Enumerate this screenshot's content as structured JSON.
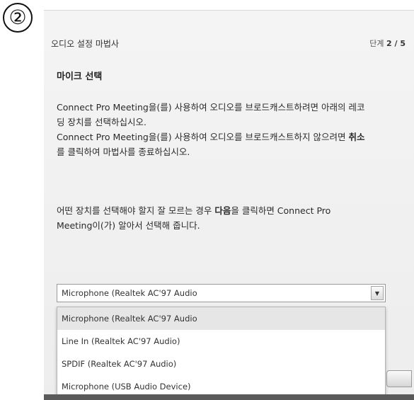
{
  "marker": {
    "label": "②"
  },
  "wizard": {
    "title": "오디오 설정 마법사",
    "step_prefix": "단계",
    "step_current": "2 / 5",
    "section_title": "마이크 선택",
    "instructions": [
      "Connect Pro Meeting을(를) 사용하여 오디오를 브로드캐스트하려면 아래의 레코",
      "딩 장치를 선택하십시오.",
      "Connect Pro Meeting을(를) 사용하여 오디오를 브로드캐스트하지 않으려면 "
    ],
    "instructions_bold": "취소",
    "instructions_tail": "를 클릭하여 마법사를 종료하십시오.",
    "hint_start": "어떤 장치를 선택해야 할지 잘 모르는 경우 ",
    "hint_bold": "다음",
    "hint_mid": "을 클릭하면 Connect Pro",
    "hint_end": "Meeting이(가) 알아서 선택해 줍니다."
  },
  "device_select": {
    "value": "Microphone (Realtek AC'97 Audio",
    "options": [
      "Microphone (Realtek AC'97 Audio",
      "Line In (Realtek AC'97 Audio)",
      "SPDIF (Realtek AC'97 Audio)",
      "Microphone (USB Audio Device)"
    ]
  },
  "colors": {
    "dialog_bg": "#f0f0f0",
    "selected_option": "#e6e6e6"
  }
}
